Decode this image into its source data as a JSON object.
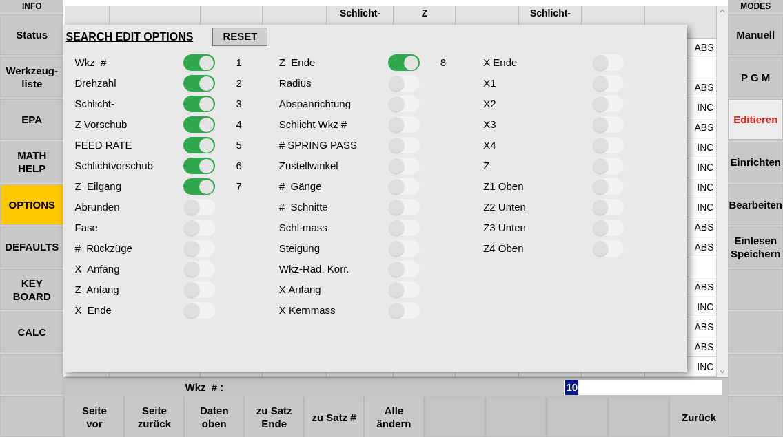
{
  "left_sidebar": {
    "header": "INFO",
    "items": [
      {
        "label": "Status",
        "selected": false
      },
      {
        "label": "Werkzeug-\nliste",
        "selected": false
      },
      {
        "label": "EPA",
        "selected": false
      },
      {
        "label": "MATH\nHELP",
        "selected": false
      },
      {
        "label": "OPTIONS",
        "selected": true
      },
      {
        "label": "DEFAULTS",
        "selected": false
      },
      {
        "label": "KEY\nBOARD",
        "selected": false
      },
      {
        "label": "CALC",
        "selected": false
      },
      {
        "selected": false
      },
      {
        "selected": false
      }
    ]
  },
  "table": {
    "columns": [
      {},
      {},
      {},
      {},
      {
        "label": "Schlicht-"
      },
      {
        "label": "Z"
      },
      {},
      {
        "label": "Schlicht-"
      },
      {},
      {}
    ],
    "rows": [
      {
        "column_10": "ABS"
      },
      {},
      {
        "column_10": "ABS"
      },
      {
        "column_10": "INC"
      },
      {
        "column_10": "ABS"
      },
      {
        "column_10": "INC"
      },
      {
        "column_10": "INC"
      },
      {
        "column_10": "INC"
      },
      {
        "column_10": "INC"
      },
      {
        "column_10": "ABS"
      },
      {
        "column_10": "ABS"
      },
      {},
      {
        "column_10": "ABS"
      },
      {
        "column_10": "INC"
      },
      {
        "column_10": "ABS"
      },
      {
        "column_10": "ABS"
      },
      {
        "column_10": "INC"
      }
    ]
  },
  "dialog": {
    "title": "SEARCH EDIT OPTIONS",
    "reset_button": "RESET",
    "columns": [
      [
        {
          "label": "Wkz  #",
          "on": true,
          "number": "1"
        },
        {
          "label": "Drehzahl",
          "on": true,
          "number": "2"
        },
        {
          "label": "Schlicht-",
          "on": true,
          "number": "3"
        },
        {
          "label": "Z Vorschub",
          "on": true,
          "number": "4"
        },
        {
          "label": "FEED RATE",
          "on": true,
          "number": "5"
        },
        {
          "label": "Schlichtvorschub",
          "on": true,
          "number": "6"
        },
        {
          "label": "Z  Eilgang",
          "on": true,
          "number": "7"
        },
        {
          "label": "Abrunden",
          "on": false
        },
        {
          "label": "Fase",
          "on": false
        },
        {
          "label": "#  Rückzüge",
          "on": false
        },
        {
          "label": "X  Anfang",
          "on": false
        },
        {
          "label": "Z  Anfang",
          "on": false
        },
        {
          "label": "X  Ende",
          "on": false
        }
      ],
      [
        {
          "label": "Z  Ende",
          "on": true,
          "number": "8"
        },
        {
          "label": "Radius",
          "on": false
        },
        {
          "label": "Abspanrichtung",
          "on": false
        },
        {
          "label": "Schlicht Wkz #",
          "on": false
        },
        {
          "label": "# SPRING PASS",
          "on": false
        },
        {
          "label": "Zustellwinkel",
          "on": false
        },
        {
          "label": "#  Gänge",
          "on": false
        },
        {
          "label": "#  Schnitte",
          "on": false
        },
        {
          "label": "Schl-mass",
          "on": false
        },
        {
          "label": "Steigung",
          "on": false
        },
        {
          "label": "Wkz-Rad. Korr.",
          "on": false
        },
        {
          "label": "X Anfang",
          "on": false
        },
        {
          "label": "X Kernmass",
          "on": false
        }
      ],
      [
        {
          "label": "X Ende",
          "on": false
        },
        {
          "label": "X1",
          "on": false
        },
        {
          "label": "X2",
          "on": false
        },
        {
          "label": "X3",
          "on": false
        },
        {
          "label": "X4",
          "on": false
        },
        {
          "label": "Z",
          "on": false
        },
        {
          "label": "Z1 Oben",
          "on": false
        },
        {
          "label": "Z2 Unten",
          "on": false
        },
        {
          "label": "Z3 Unten",
          "on": false
        },
        {
          "label": "Z4 Oben",
          "on": false
        }
      ]
    ]
  },
  "input_row": {
    "label": "Wkz  # :",
    "value": "10"
  },
  "bottom_buttons": [
    {
      "label": "Seite\nvor"
    },
    {
      "label": "Seite\nzurück"
    },
    {
      "label": "Daten\noben"
    },
    {
      "label": "zu Satz\nEnde"
    },
    {
      "label": "zu Satz  #"
    },
    {
      "label": "Alle\nändern"
    },
    {
      "kind": "blank"
    },
    {
      "kind": "blank"
    },
    {
      "kind": "blank"
    },
    {
      "kind": "blank"
    },
    {
      "label": "Zurück"
    }
  ],
  "right_sidebar": {
    "header": "MODES",
    "items": [
      {
        "label": "Manuell",
        "selected": false
      },
      {
        "label": "P G M",
        "selected": false
      },
      {
        "label": "Editieren",
        "selected": true
      },
      {
        "label": "Einrichten",
        "selected": false
      },
      {
        "label": "Bearbeiten",
        "selected": false
      },
      {
        "label": "Einlesen\nSpeichern",
        "selected": false
      },
      {
        "selected": false
      },
      {
        "selected": false
      },
      {
        "selected": false
      },
      {
        "selected": false
      }
    ]
  }
}
